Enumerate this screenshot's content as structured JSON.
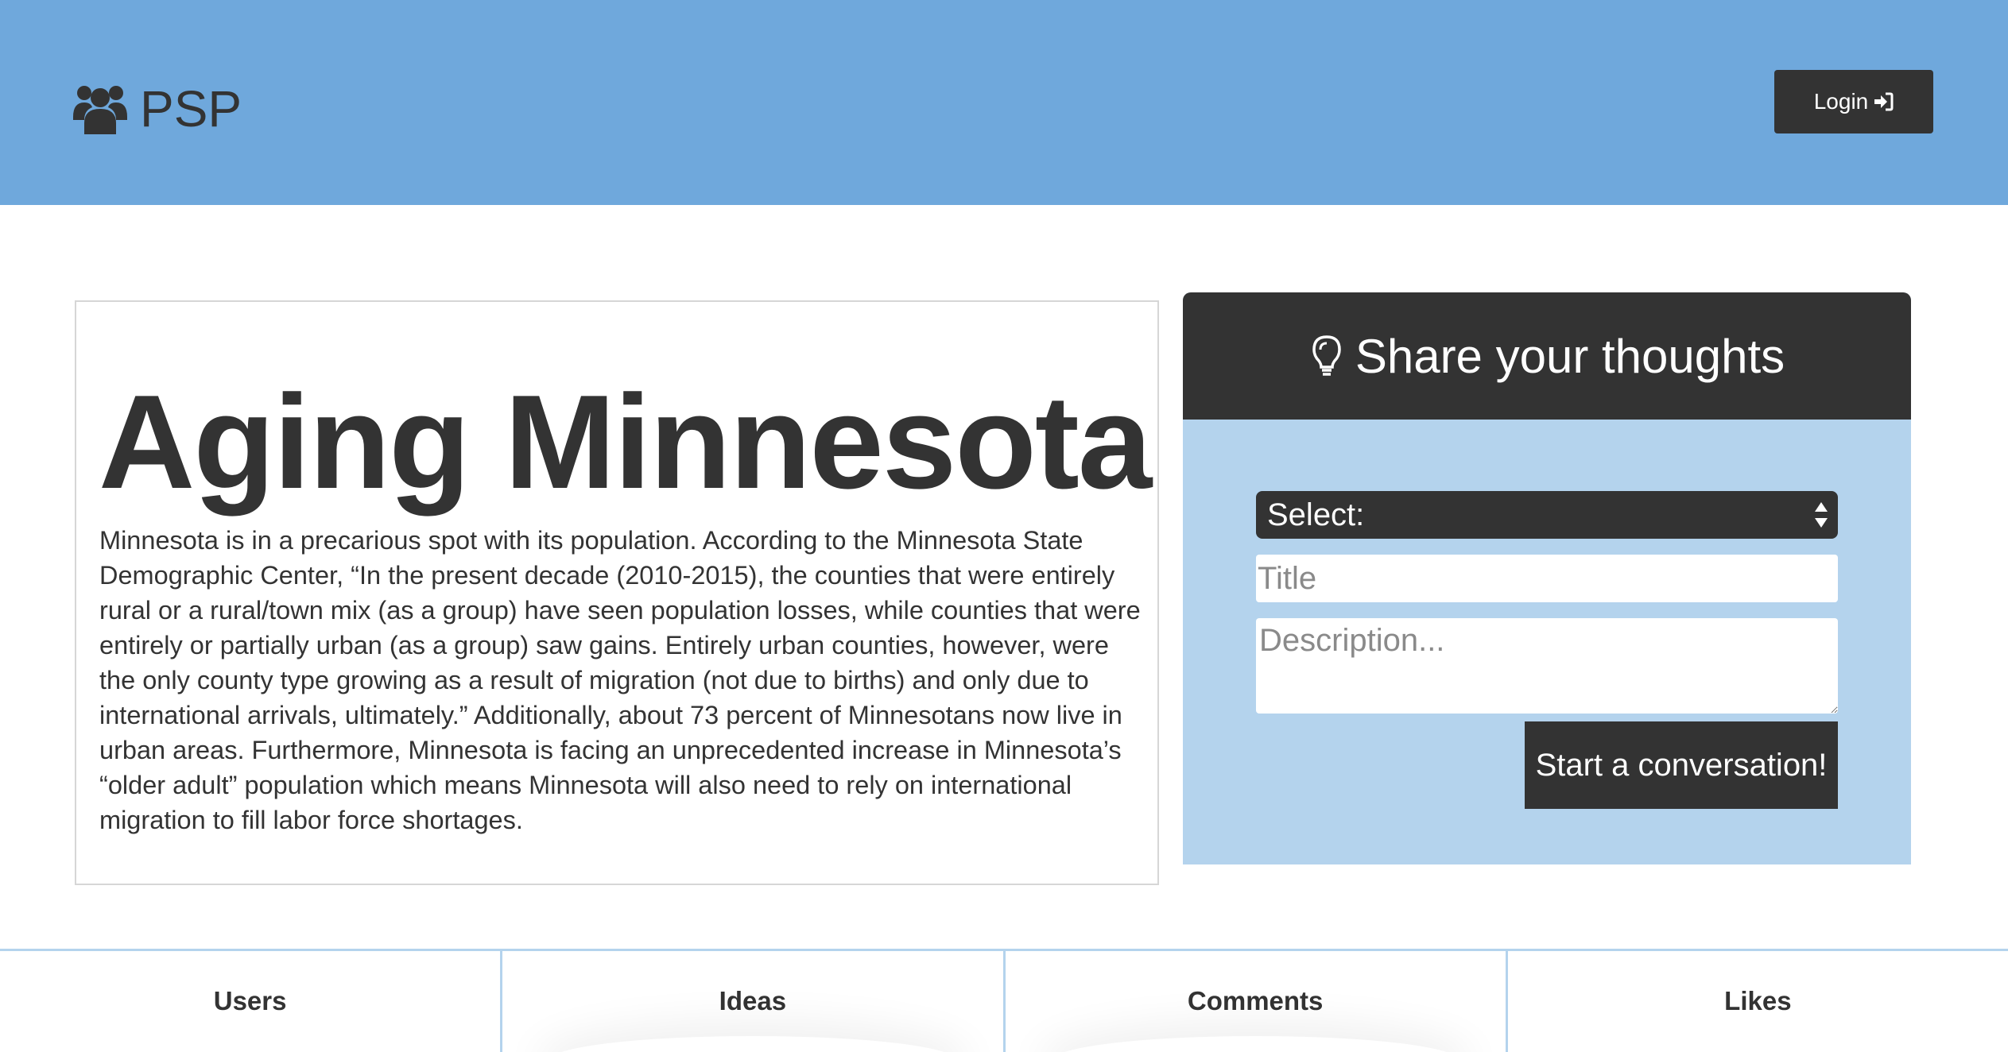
{
  "header": {
    "brand": "PSP",
    "brand_icon": "users-icon",
    "login_label": "Login",
    "login_icon": "sign-in-icon",
    "background_color": "#6fa8dc"
  },
  "article": {
    "title": "Aging Minnesota",
    "body": "Minnesota is in a precarious spot with its population. According to the Minnesota State Demographic Center, “In the present decade (2010-2015), the counties that were entirely rural or a rural/town mix (as a group) have seen population losses, while counties that were entirely or partially urban (as a group) saw gains. Entirely urban counties, however, were the only county type growing as a result of migration (not due to births) and only due to international arrivals, ultimately.” Additionally, about 73 percent of Minnesotans now live in urban areas. Furthermore, Minnesota is facing an unprecedented increase in Minnesota’s “older adult” population which means Minnesota will also need to rely on international migration to fill labor force shortages."
  },
  "share": {
    "heading": "Share your thoughts",
    "heading_icon": "lightbulb-icon",
    "select_value": "Select:",
    "title_placeholder": "Title",
    "description_placeholder": "Description...",
    "submit_label": "Start a conversation!",
    "panel_color": "#b4d3ed",
    "dark_color": "#333333"
  },
  "stats": [
    {
      "label": "Users"
    },
    {
      "label": "Ideas"
    },
    {
      "label": "Comments"
    },
    {
      "label": "Likes"
    }
  ]
}
